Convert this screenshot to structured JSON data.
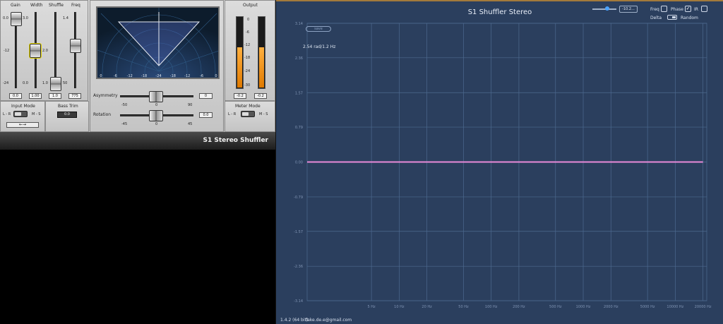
{
  "plugin": {
    "name": "S1 Stereo Shuffler",
    "faders": [
      {
        "label": "Gain",
        "value": "0.0",
        "ticks": [
          "0.0",
          "-12",
          "-24"
        ]
      },
      {
        "label": "Width",
        "value": "1.00",
        "ticks": [
          "3.0",
          "0.0"
        ]
      },
      {
        "label": "Shuffle",
        "value": "1.0",
        "ticks": [
          "1.4",
          "2.0",
          "1.0"
        ]
      },
      {
        "label": "Freq",
        "value": "775",
        "ticks": [
          "1.4",
          "50"
        ]
      }
    ],
    "scope_ticks": [
      "0",
      "-6",
      "-12",
      "-18",
      "-24",
      "-18",
      "-12",
      "-6",
      "0"
    ],
    "asymmetry": {
      "label": "Asymmetry",
      "value": "0",
      "min": "-50",
      "mid": "0",
      "max": "90"
    },
    "rotation": {
      "label": "Rotation",
      "value": "0.0",
      "min": "-45",
      "mid": "0",
      "max": "45"
    },
    "output": {
      "label": "Output",
      "left": "-0.2",
      "right": "-0.2",
      "ticks": [
        "0",
        "-6",
        "-12",
        "-18",
        "-24",
        "-30"
      ],
      "left_level": 0.56,
      "right_level": 0.56
    },
    "input_mode": {
      "label": "Input Mode",
      "left": "L - R",
      "right": "M - S",
      "arrow": "←→"
    },
    "bass_trim": {
      "label": "Bass Trim",
      "value": "0.0"
    },
    "meter_mode": {
      "label": "Meter Mode",
      "left": "L - R",
      "right": "M - S"
    }
  },
  "analyzer": {
    "title": "S1 Shuffler Stereo",
    "zoom_value": "-10.2...",
    "freq_label": "Freq",
    "phase_label": "Phase",
    "ir_label": "IR",
    "delta_label": "Delta",
    "random_label": "Random",
    "pill_label": "save",
    "info": "2.54 rad/1.2 Hz",
    "version": "1.4.2 (64 bit)",
    "email": "fake.de.e@gmail.com",
    "line_color": "#e88ad8"
  },
  "chart_data": {
    "type": "line",
    "xlabel": "",
    "ylabel": "",
    "x_scale": "log",
    "xlim": [
      1,
      22000
    ],
    "ylim": [
      -3.14,
      3.14
    ],
    "y_ticks": [
      3.14,
      2.36,
      1.57,
      0.79,
      0.0,
      -0.79,
      -1.57,
      -2.36,
      -3.14
    ],
    "y_tick_labels": [
      "3.14",
      "2.36",
      "1.57",
      "0.79",
      "0.00",
      "-0.79",
      "-1.57",
      "-2.36",
      "-3.14"
    ],
    "x_ticks": [
      5,
      10,
      20,
      50,
      100,
      200,
      500,
      1000,
      2000,
      5000,
      10000,
      20000
    ],
    "x_tick_labels": [
      "5 Hz",
      "10 Hz",
      "20 Hz",
      "50 Hz",
      "100 Hz",
      "200 Hz",
      "500 Hz",
      "1000 Hz",
      "2000 Hz",
      "5000 Hz",
      "10000 Hz",
      "20000 Hz"
    ],
    "series": [
      {
        "x": [
          1,
          20000
        ],
        "y": [
          0.0,
          0.0
        ]
      }
    ],
    "grid": true
  }
}
